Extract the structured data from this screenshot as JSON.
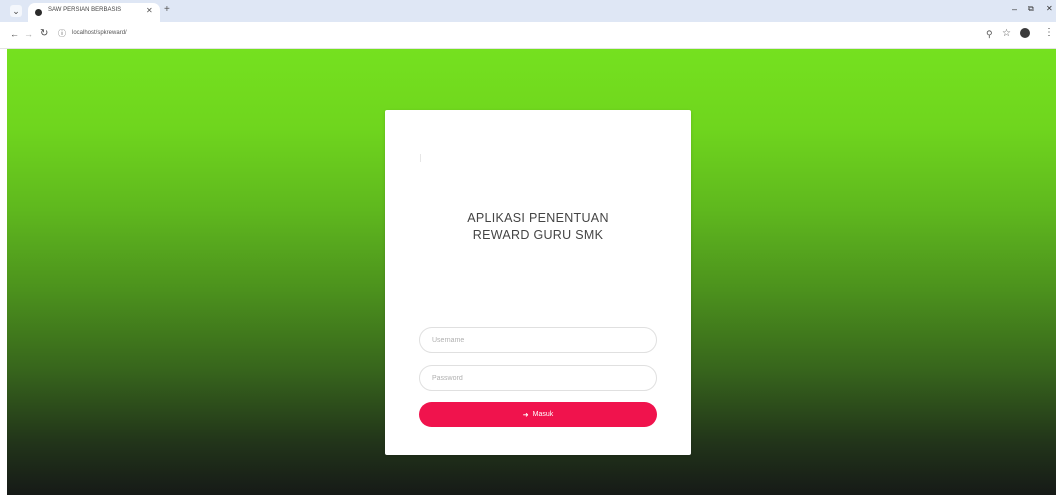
{
  "browser": {
    "tab_title": "SAW PERSIAN BERBASIS",
    "url": "localhost/spkreward/",
    "icons": {
      "tab_menu": "chevron-down-icon",
      "close": "close-icon",
      "new_tab": "plus-icon",
      "back": "arrow-left-icon",
      "forward": "arrow-right-icon",
      "reload": "reload-icon",
      "site_info": "site-info-icon",
      "zoom": "zoom-icon",
      "bookmark": "star-icon",
      "profile": "profile-icon",
      "menu": "kebab-icon",
      "minimize": "minimize-icon",
      "maximize": "maximize-icon"
    }
  },
  "login": {
    "title_line1": "APLIKASI PENENTUAN",
    "title_line2": "REWARD GURU SMK",
    "username_placeholder": "Username",
    "password_placeholder": "Password",
    "button_label": "Masuk",
    "button_icon": "sign-in-icon"
  },
  "colors": {
    "gradient_top": "#75e11f",
    "gradient_bottom": "#161a17",
    "button": "#f0134d",
    "card": "#ffffff"
  }
}
